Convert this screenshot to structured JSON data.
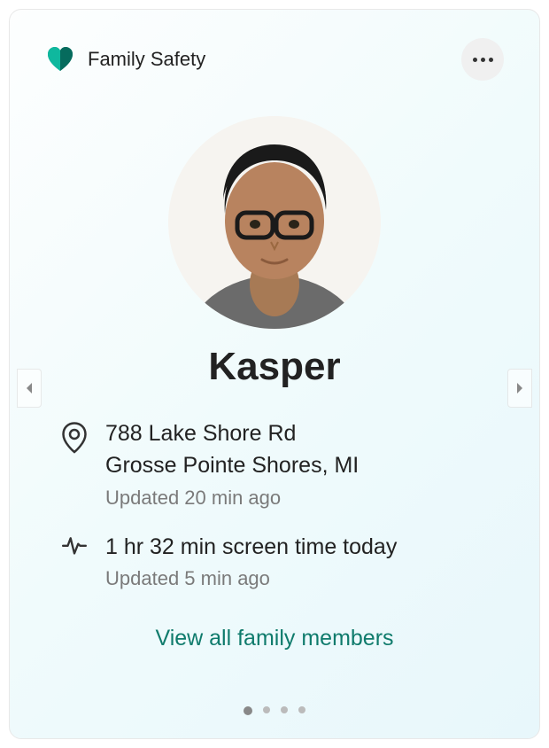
{
  "header": {
    "title": "Family Safety"
  },
  "member": {
    "name": "Kasper",
    "location": {
      "line1": "788 Lake Shore Rd",
      "line2": "Grosse Pointe Shores, MI",
      "updated": "Updated 20 min ago"
    },
    "screentime": {
      "summary": "1 hr 32 min screen time today",
      "updated": "Updated 5 min ago"
    }
  },
  "footer": {
    "view_all": "View all family members"
  },
  "pager": {
    "count": 4,
    "active": 0
  },
  "colors": {
    "accent": "#0f7b6c"
  }
}
